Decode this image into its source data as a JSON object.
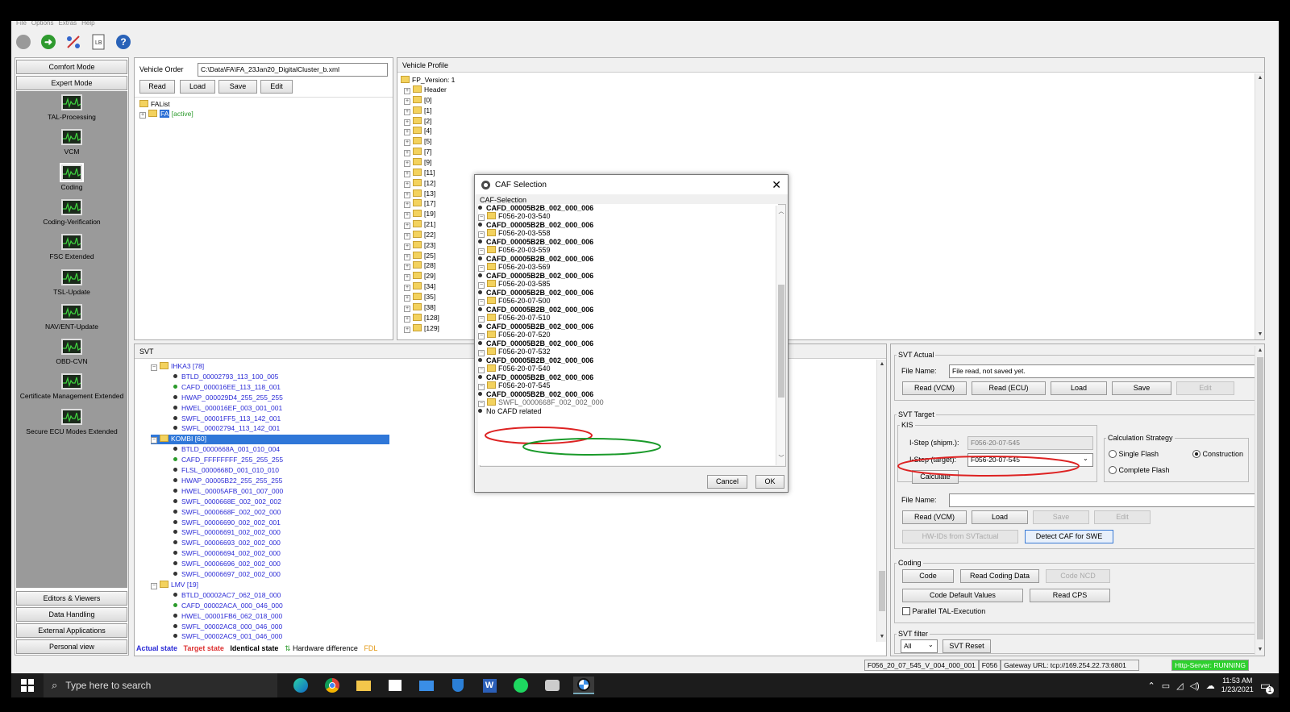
{
  "menu": {
    "items": [
      "File",
      "Options",
      "Extras",
      "Help"
    ]
  },
  "toolbar": {
    "icons": [
      "stop-icon",
      "go-icon",
      "connect-icon",
      "log-icon",
      "help-icon"
    ]
  },
  "nav": {
    "top": [
      "Comfort Mode",
      "Expert Mode"
    ],
    "items": [
      "TAL-Processing",
      "VCM",
      "Coding",
      "Coding-Verification",
      "FSC Extended",
      "TSL-Update",
      "NAV/ENT-Update",
      "OBD-CVN",
      "Certificate Management Extended",
      "Secure ECU Modes Extended"
    ],
    "selected": "Coding",
    "bottom": [
      "Editors & Viewers",
      "Data Handling",
      "External Applications",
      "Personal view"
    ]
  },
  "vehicle_order": {
    "label": "Vehicle Order",
    "path": "C:\\Data\\FA\\FA_23Jan20_DigitalCluster_b.xml",
    "buttons": [
      "Read",
      "Load",
      "Save",
      "Edit"
    ],
    "tree_root": "FAList",
    "tree_child": "FA",
    "tree_child_status": "[active]"
  },
  "vehicle_profile": {
    "header": "Vehicle Profile",
    "root": "FP_Version: 1",
    "items": [
      "Header",
      "[0]",
      "[1]",
      "[2]",
      "[4]",
      "[5]",
      "[7]",
      "[9]",
      "[11]",
      "[12]",
      "[13]",
      "[17]",
      "[19]",
      "[21]",
      "[22]",
      "[23]",
      "[25]",
      "[28]",
      "[29]",
      "[34]",
      "[35]",
      "[38]",
      "[128]",
      "[129]"
    ]
  },
  "svt": {
    "header": "SVT",
    "groups": [
      {
        "name": "IHKA3 [78]",
        "items": [
          [
            "BTLD_00002793_113_100_005",
            "k"
          ],
          [
            "CAFD_000016EE_113_118_001",
            "g"
          ],
          [
            "HWAP_000029D4_255_255_255",
            "k"
          ],
          [
            "HWEL_000016EF_003_001_001",
            "k"
          ],
          [
            "SWFL_00001FF5_113_142_001",
            "k"
          ],
          [
            "SWFL_00002794_113_142_001",
            "k"
          ]
        ]
      },
      {
        "name": "KOMBI [60]",
        "selected": true,
        "items": [
          [
            "BTLD_0000668A_001_010_004",
            "k"
          ],
          [
            "CAFD_FFFFFFFF_255_255_255",
            "g"
          ],
          [
            "FLSL_0000668D_001_010_010",
            "k"
          ],
          [
            "HWAP_00005B22_255_255_255",
            "k"
          ],
          [
            "HWEL_00005AFB_001_007_000",
            "k"
          ],
          [
            "SWFL_0000668E_002_002_002",
            "k"
          ],
          [
            "SWFL_0000668F_002_002_000",
            "k"
          ],
          [
            "SWFL_00006690_002_002_001",
            "k"
          ],
          [
            "SWFL_00006691_002_002_000",
            "k"
          ],
          [
            "SWFL_00006693_002_002_000",
            "k"
          ],
          [
            "SWFL_00006694_002_002_000",
            "k"
          ],
          [
            "SWFL_00006696_002_002_000",
            "k"
          ],
          [
            "SWFL_00006697_002_002_000",
            "k"
          ]
        ]
      },
      {
        "name": "LMV [19]",
        "items": [
          [
            "BTLD_00002AC7_062_018_000",
            "k"
          ],
          [
            "CAFD_00002ACA_000_046_000",
            "g"
          ],
          [
            "HWEL_00001FB6_062_018_000",
            "k"
          ],
          [
            "SWFL_00002AC8_000_046_000",
            "k"
          ],
          [
            "SWFL_00002AC9_001_046_000",
            "k"
          ]
        ]
      }
    ],
    "legend": {
      "actual": "Actual state",
      "target": "Target state",
      "identical": "Identical state",
      "hw": "Hardware difference",
      "fdl": "FDL",
      "hw_symbol": "⇅"
    }
  },
  "svt_actual": {
    "legend": "SVT Actual",
    "file_label": "File Name:",
    "file_value": "File read, not saved yet.",
    "buttons": [
      "Read (VCM)",
      "Read (ECU)",
      "Load",
      "Save",
      "Edit"
    ]
  },
  "svt_target": {
    "legend": "SVT Target",
    "kis": "KIS",
    "istep_shipm_label": "I-Step (shipm.):",
    "istep_shipm_value": "F056-20-07-545",
    "istep_target_label": "I-Step (target):",
    "istep_target_value": "F056-20-07-545",
    "calculate": "Calculate",
    "strategy_legend": "Calculation Strategy",
    "strategy_options": [
      "Single Flash",
      "Construction",
      "Complete Flash"
    ],
    "strategy_selected": "Construction",
    "file_label": "File Name:",
    "file_value": "",
    "buttons": [
      "Read (VCM)",
      "Load",
      "Save",
      "Edit"
    ],
    "hw_ids": "HW-IDs from SVTactual",
    "detect_caf": "Detect CAF for SWE"
  },
  "coding": {
    "legend": "Coding",
    "buttons": [
      "Code",
      "Read Coding Data",
      "Code NCD",
      "Code Default Values",
      "Read CPS"
    ],
    "parallel": "Parallel TAL-Execution"
  },
  "svt_filter": {
    "legend": "SVT filter",
    "value": "All",
    "reset": "SVT Reset"
  },
  "status_bar": {
    "file": "F056_20_07_545_V_004_000_001",
    "series": "F056",
    "gateway": "Gateway URL: tcp://169.254.22.73:6801",
    "server": "Http-Server: RUNNING"
  },
  "dialog": {
    "title": "CAF Selection",
    "group": "CAF-Selection",
    "rows": [
      {
        "t": "c",
        "text": "CAFD_00005B2B_002_000_006"
      },
      {
        "t": "f",
        "text": "F056-20-03-540"
      },
      {
        "t": "c",
        "text": "CAFD_00005B2B_002_000_006"
      },
      {
        "t": "f",
        "text": "F056-20-03-558"
      },
      {
        "t": "c",
        "text": "CAFD_00005B2B_002_000_006"
      },
      {
        "t": "f",
        "text": "F056-20-03-559"
      },
      {
        "t": "c",
        "text": "CAFD_00005B2B_002_000_006"
      },
      {
        "t": "f",
        "text": "F056-20-03-569"
      },
      {
        "t": "c",
        "text": "CAFD_00005B2B_002_000_006"
      },
      {
        "t": "f",
        "text": "F056-20-03-585"
      },
      {
        "t": "c",
        "text": "CAFD_00005B2B_002_000_006"
      },
      {
        "t": "f",
        "text": "F056-20-07-500"
      },
      {
        "t": "c",
        "text": "CAFD_00005B2B_002_000_006"
      },
      {
        "t": "f",
        "text": "F056-20-07-510"
      },
      {
        "t": "c",
        "text": "CAFD_00005B2B_002_000_006"
      },
      {
        "t": "f",
        "text": "F056-20-07-520"
      },
      {
        "t": "c",
        "text": "CAFD_00005B2B_002_000_006"
      },
      {
        "t": "f",
        "text": "F056-20-07-532"
      },
      {
        "t": "c",
        "text": "CAFD_00005B2B_002_000_006"
      },
      {
        "t": "f",
        "text": "F056-20-07-540"
      },
      {
        "t": "c",
        "text": "CAFD_00005B2B_002_000_006"
      },
      {
        "t": "f",
        "text": "F056-20-07-545"
      },
      {
        "t": "c",
        "text": "CAFD_00005B2B_002_000_006"
      },
      {
        "t": "s",
        "text": "SWFL_0000668F_002_002_000"
      },
      {
        "t": "n",
        "text": "No CAFD related"
      }
    ],
    "cancel": "Cancel",
    "ok": "OK"
  },
  "taskbar": {
    "search": "Type here to search",
    "time": "11:53 AM",
    "date": "1/23/2021",
    "notification_count": "1"
  }
}
